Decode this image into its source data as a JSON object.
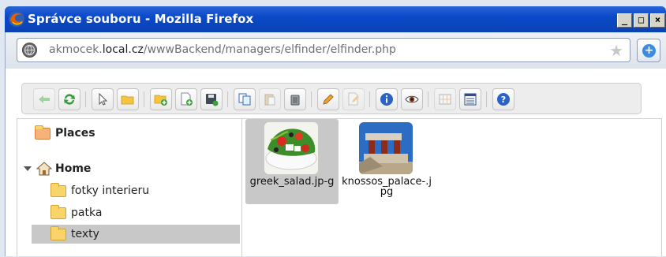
{
  "window": {
    "title": "Správce souboru - Mozilla Firefox",
    "controls": {
      "minimize": "_",
      "maximize": "□",
      "close": "×"
    }
  },
  "urlbar": {
    "url_prefix": "akmocek.",
    "url_domain": "local.cz",
    "url_path": "/wwwBackend/managers/elfinder/elfinder.php"
  },
  "toolbar": {
    "buttons": [
      "back-icon",
      "reload-icon",
      "select-icon",
      "open-folder-icon",
      "new-folder-icon",
      "new-file-icon",
      "save-icon",
      "copy-icon",
      "paste-icon",
      "delete-icon",
      "rename-icon",
      "edit-icon",
      "info-icon",
      "preview-icon",
      "icons-view-icon",
      "list-view-icon",
      "help-icon"
    ]
  },
  "tree": {
    "places_label": "Places",
    "home_label": "Home",
    "folders": [
      "fotky interieru",
      "patka",
      "texty"
    ],
    "selected_folder": "texty"
  },
  "files": [
    {
      "name": "greek_salad.jpg",
      "display": "greek_salad.jp-g",
      "selected": true
    },
    {
      "name": "knossos_palace.jpg",
      "display": "knossos_palace-.jpg",
      "selected": false
    }
  ],
  "colors": {
    "titlebar": "#0a49c8",
    "selection": "#c8c8c8",
    "folder": "#f7d56a"
  }
}
